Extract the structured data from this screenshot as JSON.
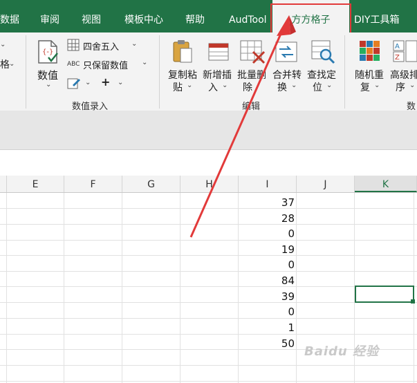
{
  "tabs": [
    {
      "label": "数据"
    },
    {
      "label": "审阅"
    },
    {
      "label": "视图"
    },
    {
      "label": "模板中心"
    },
    {
      "label": "帮助"
    },
    {
      "label": "AudTool"
    },
    {
      "label": "方方格子",
      "active": true
    },
    {
      "label": "DIY工具箱"
    }
  ],
  "ribbon": {
    "left_partial": {
      "label": "格"
    },
    "numeric_group": {
      "value_button": "数值",
      "round_label": "四舍五入",
      "keep_value_label": "只保留数值",
      "abc_text": "ABC",
      "plus_text": "+",
      "group_label": "数值录入"
    },
    "edit_group": {
      "copy_paste_line1": "复制粘",
      "copy_paste_line2": "贴",
      "insert_line1": "新增插",
      "insert_line2": "入",
      "batch_delete_line1": "批量删",
      "batch_delete_line2": "除",
      "merge_line1": "合并转",
      "merge_line2": "换",
      "find_line1": "查找定",
      "find_line2": "位",
      "group_label": "编辑"
    },
    "right_group": {
      "random_line1": "随机重",
      "random_line2": "复",
      "sort_line1": "高级排",
      "sort_line2": "序",
      "group_label_partial": "数"
    }
  },
  "columns": [
    "E",
    "F",
    "G",
    "H",
    "I",
    "J",
    "K"
  ],
  "selected_column": "K",
  "column_i_values": [
    "37",
    "28",
    "0",
    "19",
    "0",
    "84",
    "39",
    "0",
    "1",
    "50"
  ],
  "watermark": "Baidu 经验",
  "colors": {
    "brand": "#217346",
    "highlight": "#e23a3a"
  }
}
